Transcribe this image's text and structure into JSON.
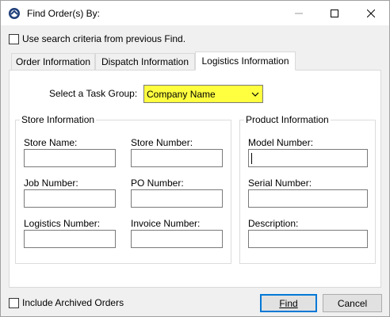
{
  "window": {
    "title": "Find Order(s) By:",
    "icons": {
      "app": "app-icon",
      "minimize": "minimize-icon",
      "maximize": "maximize-icon",
      "close": "close-icon"
    }
  },
  "options": {
    "use_previous_label": "Use search criteria from previous Find.",
    "use_previous_checked": false,
    "include_archived_label": "Include Archived Orders",
    "include_archived_checked": false
  },
  "tabs": [
    {
      "label": "Order Information",
      "active": false
    },
    {
      "label": "Dispatch Information",
      "active": false
    },
    {
      "label": "Logistics Information",
      "active": true
    }
  ],
  "task_group": {
    "label": "Select a Task Group:",
    "value": "Company Name",
    "highlight_color": "#ffff40"
  },
  "store_info": {
    "title": "Store Information",
    "fields": [
      {
        "label": "Store Name:",
        "value": ""
      },
      {
        "label": "Store Number:",
        "value": ""
      },
      {
        "label": "Job Number:",
        "value": ""
      },
      {
        "label": "PO Number:",
        "value": ""
      },
      {
        "label": "Logistics Number:",
        "value": ""
      },
      {
        "label": "Invoice Number:",
        "value": ""
      }
    ]
  },
  "product_info": {
    "title": "Product Information",
    "fields": [
      {
        "label": "Model Number:",
        "value": ""
      },
      {
        "label": "Serial Number:",
        "value": ""
      },
      {
        "label": "Description:",
        "value": ""
      }
    ]
  },
  "buttons": {
    "find": "Find",
    "cancel": "Cancel"
  },
  "colors": {
    "accent": "#0078d7",
    "panel": "#ffffff",
    "chrome": "#f0f0f0"
  }
}
